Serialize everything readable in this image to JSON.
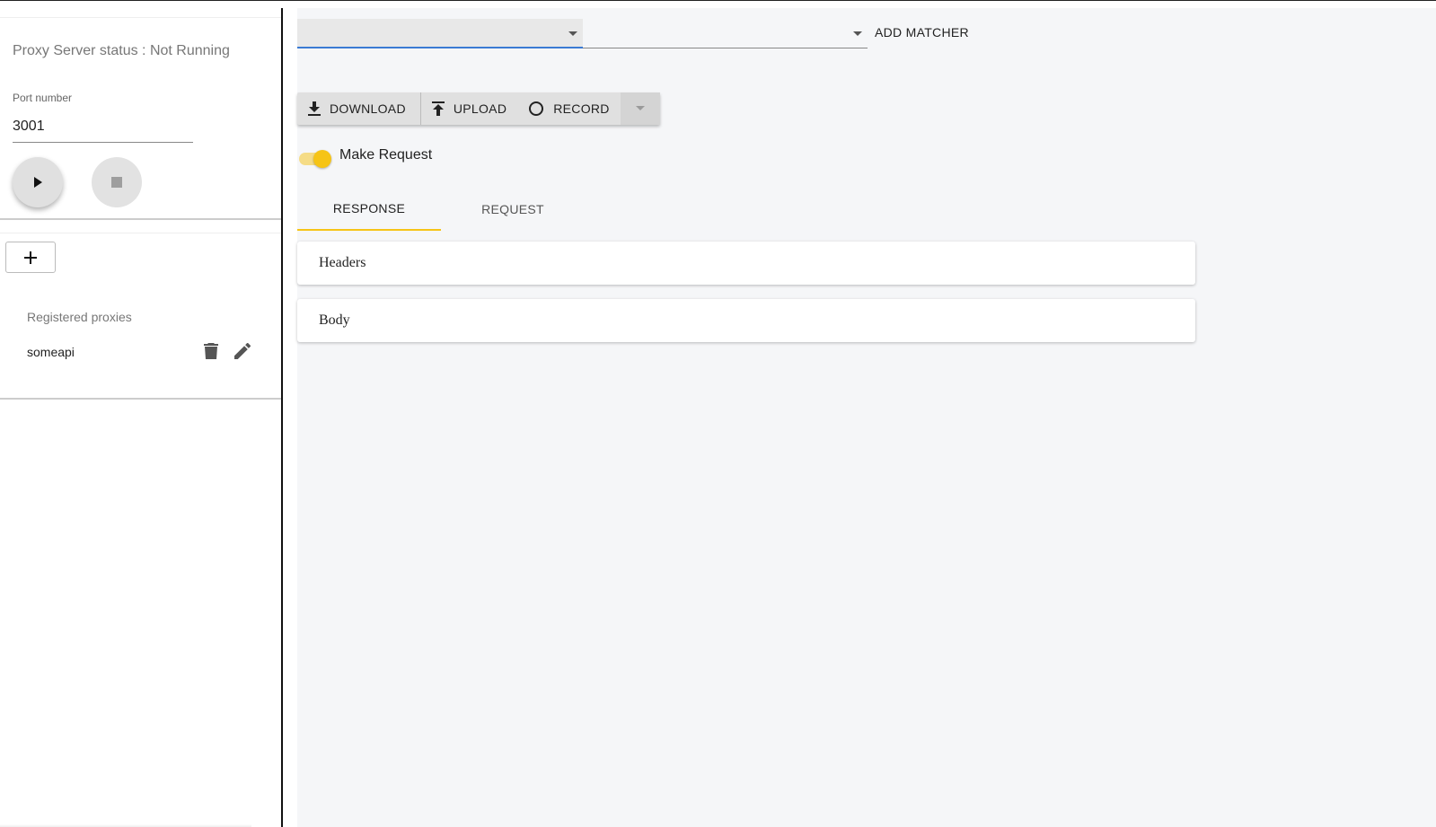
{
  "sidebar": {
    "status_text": "Proxy Server status : Not Running",
    "port_label": "Port number",
    "port_value": "3001",
    "registered_title": "Registered proxies",
    "proxies": [
      {
        "name": "someapi"
      }
    ]
  },
  "toolbar": {
    "add_matcher_label": "ADD MATCHER",
    "download_label": "DOWNLOAD",
    "upload_label": "UPLOAD",
    "record_label": "RECORD"
  },
  "make_request": {
    "label": "Make Request",
    "enabled": true
  },
  "tabs": [
    {
      "label": "RESPONSE",
      "active": true
    },
    {
      "label": "REQUEST",
      "active": false
    }
  ],
  "panels": {
    "headers_label": "Headers",
    "body_label": "Body"
  },
  "colors": {
    "accent": "#f6c416",
    "select_focus": "#3b7bd4"
  }
}
